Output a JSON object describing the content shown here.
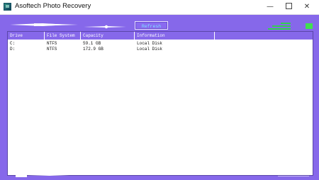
{
  "window": {
    "title": "Asoftech Photo Recovery",
    "minimize_glyph": "—",
    "close_glyph": "✕"
  },
  "toolbar": {
    "refresh_label": "Refresh"
  },
  "drives_table": {
    "columns": [
      "Drive",
      "File System",
      "Capacity",
      "Information",
      ""
    ],
    "rows": [
      [
        "C:",
        "NTFS",
        "59.1 GB",
        "Local Disk"
      ],
      [
        "D:",
        "NTFS",
        "172.9 GB",
        "Local Disk"
      ]
    ]
  },
  "colors": {
    "background": "#8668ea",
    "panel": "#ffffff",
    "refresh_text": "#7fe6ff",
    "status_green": "#40e050"
  }
}
